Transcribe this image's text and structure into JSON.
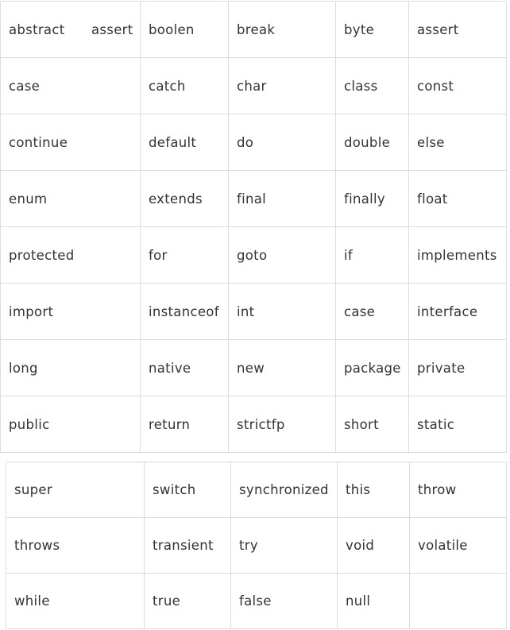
{
  "table1": {
    "rows": [
      [
        "abstract",
        "boolen",
        "break",
        "byte",
        "assert"
      ],
      [
        "case",
        "catch",
        "char",
        "class",
        "const"
      ],
      [
        "continue",
        "default",
        "do",
        "double",
        "else"
      ],
      [
        "enum",
        "extends",
        "final",
        "finally",
        "float"
      ],
      [
        "protected",
        "for",
        "goto",
        "if",
        "implements"
      ],
      [
        "import",
        "instanceof",
        "int",
        "case",
        "interface"
      ],
      [
        "long",
        "native",
        "new",
        "package",
        "private"
      ],
      [
        "public",
        "return",
        "strictfp",
        "short",
        "static"
      ]
    ],
    "first_cell_extra": "assert"
  },
  "table2": {
    "rows": [
      [
        "super",
        "switch",
        "synchronized",
        "this",
        "throw"
      ],
      [
        "throws",
        "transient",
        "try",
        "void",
        "volatile"
      ],
      [
        "while",
        "true",
        "false",
        "null",
        ""
      ]
    ]
  }
}
